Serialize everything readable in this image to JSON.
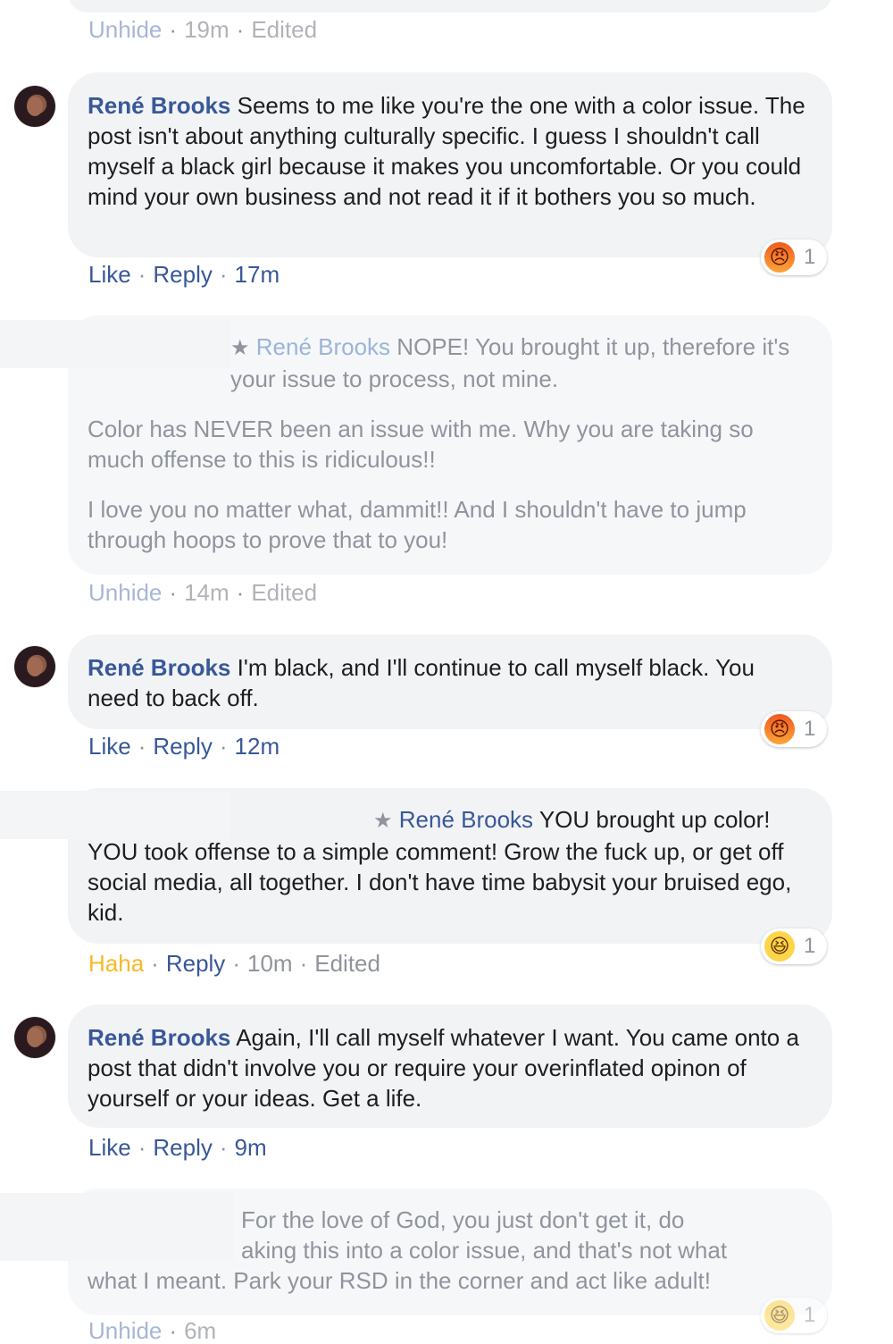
{
  "names": {
    "rene": "René Brooks"
  },
  "separator": "·",
  "comments": [
    {
      "actions": {
        "unhide": "Unhide",
        "time": "19m",
        "edited": "Edited"
      }
    },
    {
      "author": "René Brooks",
      "text": "Seems to me like you're the one with a color issue. The post isn't about anything culturally specific. I guess I shouldn't call myself a black girl because it makes you uncomfortable. Or you could mind your own business and not read it if it bothers you so much.",
      "actions": {
        "like": "Like",
        "reply": "Reply",
        "time": "17m"
      },
      "reaction": {
        "type": "angry-icon",
        "count": "1"
      }
    },
    {
      "mention": "René Brooks",
      "paragraphs": [
        "NOPE! You brought it up, therefore it's your issue to process, not mine.",
        "Color has NEVER been an issue with me. Why you are taking so much offense to this is ridiculous!!",
        "I love you no matter what, dammit!! And I shouldn't have to jump through hoops to prove that to you!"
      ],
      "actions": {
        "unhide": "Unhide",
        "time": "14m",
        "edited": "Edited"
      }
    },
    {
      "author": "René Brooks",
      "text": "I'm black, and I'll continue to call myself black. You need to back off.",
      "actions": {
        "like": "Like",
        "reply": "Reply",
        "time": "12m"
      },
      "reaction": {
        "type": "angry-icon",
        "count": "1"
      }
    },
    {
      "mention": "René Brooks",
      "text": "YOU brought up color! YOU took offense to a simple comment! Grow the fuck up, or get off social media, all together. I don't have time babysit your bruised ego, kid.",
      "actions": {
        "haha": "Haha",
        "reply": "Reply",
        "time": "10m",
        "edited": "Edited"
      },
      "reaction": {
        "type": "haha-icon",
        "count": "1"
      }
    },
    {
      "author": "René Brooks",
      "text": "Again, I'll call myself whatever I want. You came onto a post that didn't involve you or require your overinflated opinon of yourself or your ideas. Get a life.",
      "actions": {
        "like": "Like",
        "reply": "Reply",
        "time": "9m"
      }
    },
    {
      "line1": "For the love of God, you just don't get it, do",
      "line2": "aking this into a color issue, and that's not what",
      "line3": "what I meant. Park your RSD in the corner and act like adult!",
      "actions": {
        "unhide": "Unhide",
        "time": "6m"
      },
      "reaction": {
        "type": "haha-icon",
        "count": "1"
      }
    }
  ],
  "colors": {
    "link": "#385898",
    "bubble": "#f2f3f5",
    "haha": "#f7b928",
    "meta": "#90949c"
  }
}
